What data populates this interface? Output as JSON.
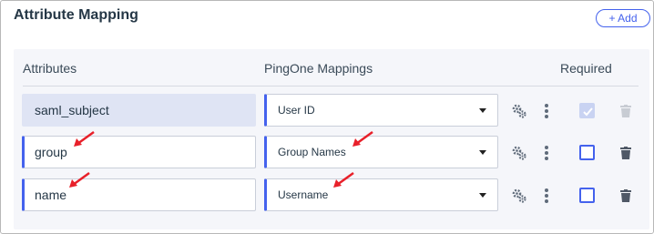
{
  "section": {
    "title": "Attribute Mapping",
    "add_label": "+ Add"
  },
  "headers": {
    "attributes": "Attributes",
    "mappings": "PingOne Mappings",
    "required": "Required"
  },
  "rows": [
    {
      "attribute": "saml_subject",
      "mapping": "User ID",
      "required": true,
      "attribute_readonly": true,
      "required_disabled": true,
      "delete_disabled": true
    },
    {
      "attribute": "group",
      "mapping": "Group Names",
      "required": false,
      "attribute_readonly": false,
      "required_disabled": false,
      "delete_disabled": false
    },
    {
      "attribute": "name",
      "mapping": "Username",
      "required": false,
      "attribute_readonly": false,
      "required_disabled": false,
      "delete_disabled": false
    }
  ],
  "icons": {
    "row_actions": [
      "gear-icon",
      "kebab-icon"
    ],
    "delete": "trash-icon",
    "annotations": "red-arrow-icon"
  },
  "colors": {
    "accent": "#4462ed",
    "panel": "#f5f6fa",
    "readonly_field": "#dfe4f4",
    "annotation": "#e8202a"
  }
}
